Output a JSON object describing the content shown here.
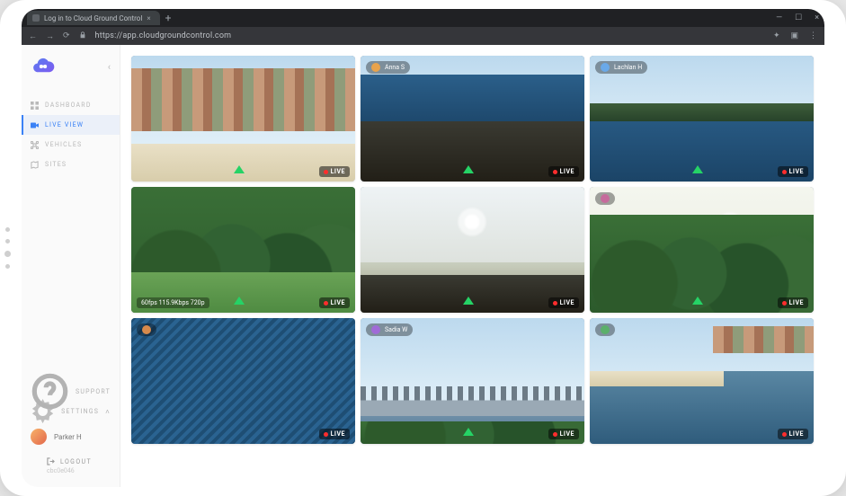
{
  "browser": {
    "tab_title": "Log in to Cloud Ground Control",
    "url": "https://app.cloudgroundcontrol.com"
  },
  "sidebar": {
    "nav": [
      {
        "label": "DASHBOARD",
        "icon": "dashboard-icon"
      },
      {
        "label": "LIVE VIEW",
        "icon": "video-icon"
      },
      {
        "label": "VEHICLES",
        "icon": "drone-icon"
      },
      {
        "label": "SITES",
        "icon": "map-icon"
      }
    ],
    "active_index": 1,
    "support_label": "SUPPORT",
    "settings_label": "SETTINGS",
    "user_name": "Parker H",
    "logout_label": "LOGOUT",
    "version": "cbc0e046"
  },
  "feeds": [
    {
      "operator": "",
      "live": "LIVE",
      "info": ""
    },
    {
      "operator": "Anna S",
      "live": "LIVE",
      "info": ""
    },
    {
      "operator": "Lachlan H",
      "live": "LIVE",
      "info": ""
    },
    {
      "operator": "",
      "live": "LIVE",
      "info": "60fps 115.9Kbps 720p"
    },
    {
      "operator": "",
      "live": "LIVE",
      "info": ""
    },
    {
      "operator": "",
      "live": "LIVE",
      "info": ""
    },
    {
      "operator": "",
      "live": "LIVE",
      "info": ""
    },
    {
      "operator": "Sadia W",
      "live": "LIVE",
      "info": ""
    },
    {
      "operator": "",
      "live": "LIVE",
      "info": ""
    }
  ],
  "colors": {
    "accent": "#3b82f6",
    "live": "#ff2d2d",
    "signal": "#25d366"
  }
}
